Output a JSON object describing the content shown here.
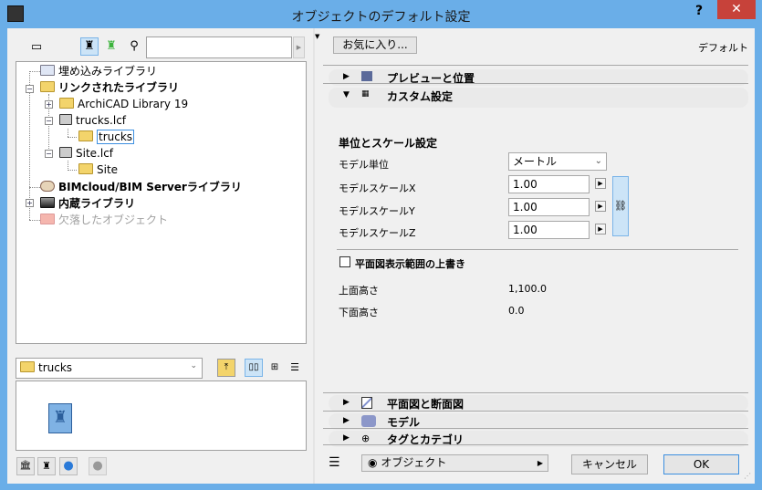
{
  "window": {
    "title": "オブジェクトのデフォルト設定",
    "help": "?",
    "close": "✕"
  },
  "library_tree": {
    "items": [
      {
        "label": "埋め込みライブラリ",
        "bold": false
      },
      {
        "label": "リンクされたライブラリ",
        "bold": true
      },
      {
        "label": "ArchiCAD Library 19",
        "bold": false
      },
      {
        "label": "trucks.lcf",
        "bold": false
      },
      {
        "label": "trucks",
        "bold": false,
        "selected": true
      },
      {
        "label": "Site.lcf",
        "bold": false
      },
      {
        "label": "Site",
        "bold": false
      },
      {
        "label": "BIMcloud/BIM Serverライブラリ",
        "bold": true
      },
      {
        "label": "内蔵ライブラリ",
        "bold": true
      },
      {
        "label": "欠落したオブジェクト",
        "bold": false,
        "disabled": true
      }
    ]
  },
  "search": {
    "value": ""
  },
  "folder_select": {
    "value": "trucks"
  },
  "toolbar": {
    "favorites_label": "お気に入り...",
    "default_label": "デフォルト"
  },
  "sections": {
    "preview": "プレビューと位置",
    "custom": "カスタム設定",
    "plan": "平面図と断面図",
    "model": "モデル",
    "tags": "タグとカテゴリ"
  },
  "custom": {
    "heading": "単位とスケール設定",
    "model_unit_label": "モデル単位",
    "model_unit_value": "メートル",
    "scale_x_label": "モデルスケールX",
    "scale_x": "1.00",
    "scale_y_label": "モデルスケールY",
    "scale_y": "1.00",
    "scale_z_label": "モデルスケールZ",
    "scale_z": "1.00",
    "override_label": "平面図表示範囲の上書き",
    "override_checked": false,
    "top_label": "上面高さ",
    "top_value": "1,100.0",
    "bottom_label": "下面高さ",
    "bottom_value": "0.0"
  },
  "footer": {
    "layer_value": "オブジェクト",
    "cancel": "キャンセル",
    "ok": "OK"
  }
}
